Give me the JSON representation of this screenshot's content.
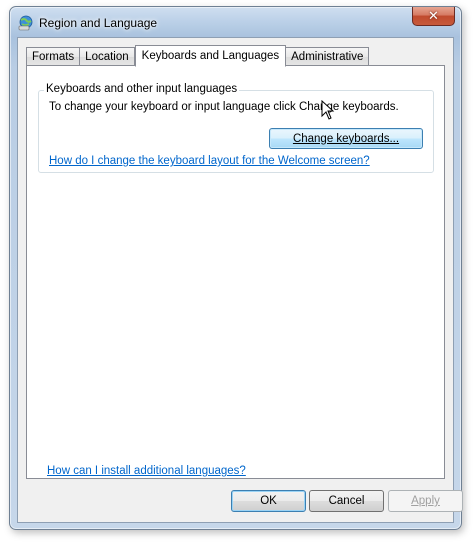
{
  "window": {
    "title": "Region and Language",
    "close_glyph": "✕"
  },
  "tabs": [
    {
      "label": "Formats"
    },
    {
      "label": "Location"
    },
    {
      "label": "Keyboards and Languages",
      "active": true
    },
    {
      "label": "Administrative"
    }
  ],
  "keyboards_group": {
    "legend": "Keyboards and other input languages",
    "description": "To change your keyboard or input language click Change keyboards.",
    "button_label": "Change keyboards...",
    "welcome_link": "How do I change the keyboard layout for the Welcome screen?"
  },
  "install_link": "How can I install additional languages?",
  "footer": {
    "ok": "OK",
    "cancel": "Cancel",
    "apply": "Apply",
    "apply_enabled": false
  },
  "icons": {
    "app": "globe-keyboard-icon",
    "cursor": "mouse-pointer-icon"
  },
  "colors": {
    "link": "#0066cc",
    "accent_button_border": "#3c7fb1",
    "close_button": "#c75a3b"
  }
}
